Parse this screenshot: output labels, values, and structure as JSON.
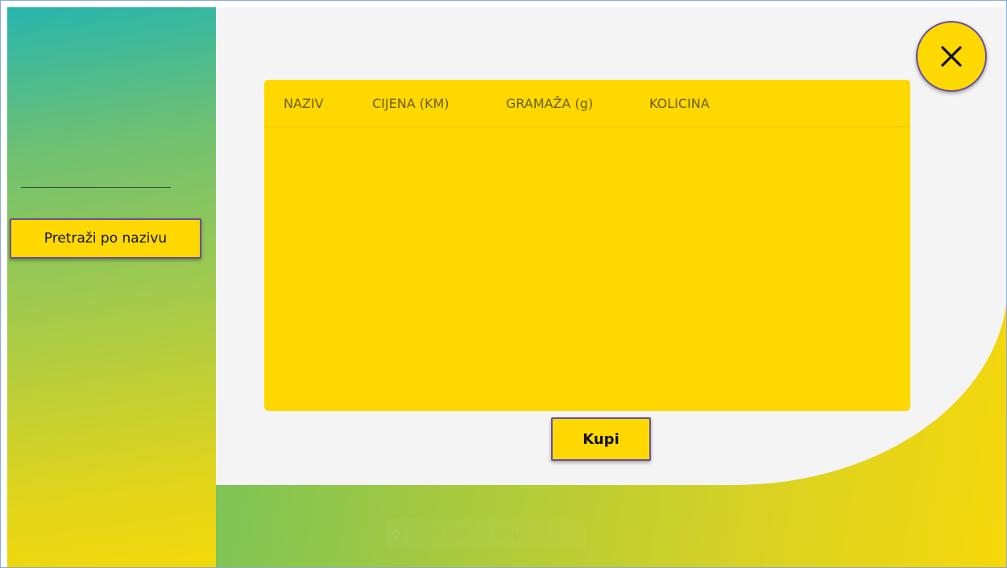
{
  "sidebar": {
    "search_button_label": "Pretraži po nazivu"
  },
  "table": {
    "columns": [
      "NAZIV",
      "CIJENA (KM)",
      "GRAMAŽA (g)",
      "KOLICINA"
    ],
    "rows": []
  },
  "buy_button_label": "Kupi",
  "close_button": {
    "icon": "close-icon"
  },
  "snip_overlay": {
    "label": "Rectangular Snip"
  },
  "colors": {
    "accent": "#ffd800",
    "border_accent": "#6b4f9a",
    "panel": "#f4f4f4",
    "gradient_start": "#27b5ad",
    "gradient_end": "#f5d80a"
  }
}
